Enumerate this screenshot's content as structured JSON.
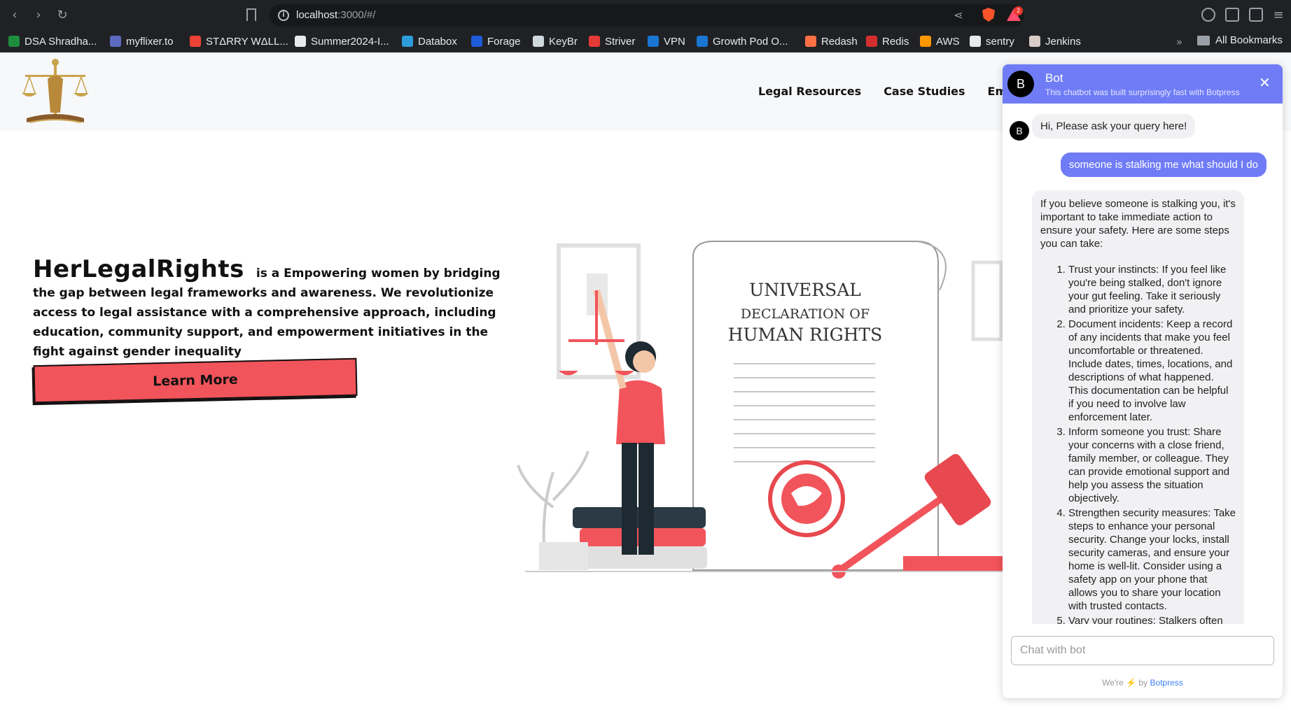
{
  "browser": {
    "url_host": "localhost",
    "url_rest": ":3000/#/",
    "rewards_badge": "2",
    "bookmarks": [
      {
        "label": "DSA Shradha...",
        "color": "#1e8e3e"
      },
      {
        "label": "myflixer.to",
        "color": "#5c6bc0"
      },
      {
        "label": "STΔRRY WΔLL...",
        "color": "#ea4335"
      },
      {
        "label": "Summer2024-I...",
        "color": "#e8eaed"
      },
      {
        "label": "Databox",
        "color": "#2d9cdb"
      },
      {
        "label": "Forage",
        "color": "#1e5bd8"
      },
      {
        "label": "KeyBr",
        "color": "#cfd8dc"
      },
      {
        "label": "Striver",
        "color": "#e53935"
      },
      {
        "label": "VPN",
        "color": "#1976d2"
      },
      {
        "label": "Growth Pod O...",
        "color": "#1976d2"
      },
      {
        "label": "Redash",
        "color": "#ff7043"
      },
      {
        "label": "Redis",
        "color": "#d32f2f"
      },
      {
        "label": "AWS",
        "color": "#ff9900"
      },
      {
        "label": "sentry",
        "color": "#e8eaed"
      },
      {
        "label": "Jenkins",
        "color": "#d7ccc8"
      }
    ],
    "bookmarks_more": "»",
    "all_bookmarks": "All Bookmarks"
  },
  "site": {
    "nav": [
      "Legal Resources",
      "Case Studies",
      "Empower"
    ],
    "brand": "HerLegalRights",
    "description": "is a Empowering women by bridging the gap between legal frameworks and awareness. We revolutionize access to legal assistance with a comprehensive approach, including education, community support, and empowerment initiatives in the fight against gender inequality",
    "learn_more": "Learn More",
    "illustration": {
      "line1": "UNIVERSAL",
      "line2": "DECLARATION OF",
      "line3": "HUMAN RIGHTS"
    }
  },
  "chatbot": {
    "avatar_letter": "B",
    "title": "Bot",
    "subtitle": "This chatbot was built surprisingly fast with Botpress",
    "close": "✕",
    "greeting": "Hi, Please ask your query here!",
    "user_message": "someone is stalking me what should I do",
    "response_intro": "If you believe someone is stalking you, it's important to take immediate action to ensure your safety. Here are some steps you can take:",
    "response_steps": [
      "Trust your instincts: If you feel like you're being stalked, don't ignore your gut feeling. Take it seriously and prioritize your safety.",
      "Document incidents: Keep a record of any incidents that make you feel uncomfortable or threatened. Include dates, times, locations, and descriptions of what happened. This documentation can be helpful if you need to involve law enforcement later.",
      "Inform someone you trust: Share your concerns with a close friend, family member, or colleague. They can provide emotional support and help you assess the situation objectively.",
      "Strengthen security measures: Take steps to enhance your personal security. Change your locks, install security cameras, and ensure your home is well-lit. Consider using a safety app on your phone that allows you to share your location with trusted contacts.",
      "Vary your routines: Stalkers often"
    ],
    "input_placeholder": "Chat with bot",
    "powered_prefix": "We're",
    "powered_bolt": "⚡",
    "powered_by": "by",
    "powered_link": "Botpress"
  },
  "colors": {
    "accent": "#f2545b",
    "bot_header": "#6f7cf6",
    "logo_gold": "#c9a24a"
  }
}
